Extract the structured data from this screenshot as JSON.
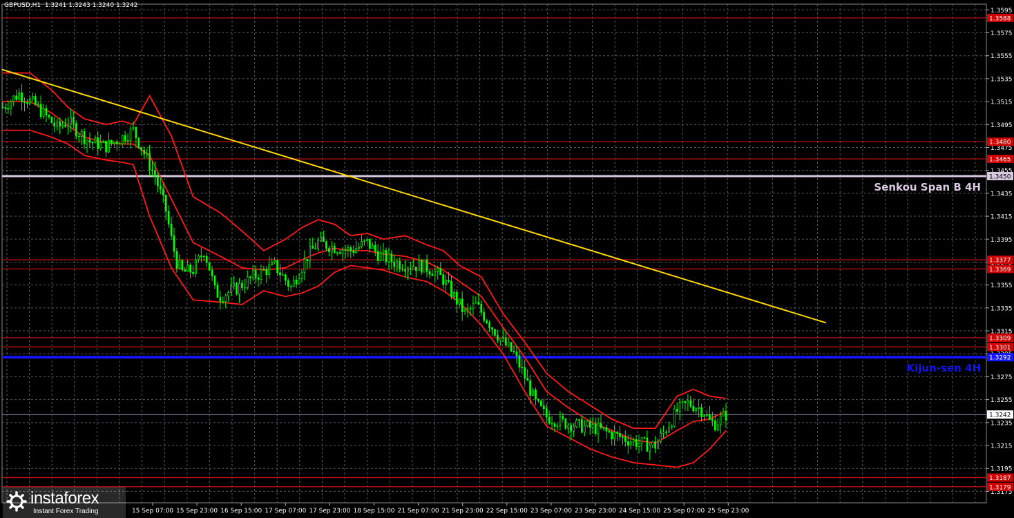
{
  "header": {
    "title": "GBPUSD,H1  1.3241 1.3243 1.3240 1.3242"
  },
  "watermark": {
    "brand": "instaforex",
    "tagline": "Instant Forex Trading"
  },
  "colors": {
    "background": "#000000",
    "grid": "#5a5a5a",
    "candle": "#00ff00",
    "bollinger": "#ff1a1a",
    "trendline": "#ffd700",
    "levels": "#d01010",
    "kijun": "#1515ff",
    "senkou": "#d8c8e0"
  },
  "chart_data": {
    "type": "candlestick",
    "symbol": "GBPUSD",
    "timeframe": "H1",
    "ylim": [
      1.3165,
      1.36
    ],
    "y_ticks": [
      "1.3595",
      "1.3575",
      "1.3555",
      "1.3535",
      "1.3515",
      "1.3495",
      "1.3475",
      "1.3455",
      "1.3435",
      "1.3415",
      "1.3395",
      "1.3375",
      "1.3355",
      "1.3335",
      "1.3315",
      "1.3295",
      "1.3275",
      "1.3255",
      "1.3235",
      "1.3215",
      "1.3195",
      "1.3175"
    ],
    "x_ticks": [
      "15 Sep 07:00",
      "15 Sep 23:00",
      "16 Sep 15:00",
      "17 Sep 07:00",
      "17 Sep 23:00",
      "18 Sep 15:00",
      "21 Sep 07:00",
      "21 Sep 23:00",
      "22 Sep 15:00",
      "23 Sep 07:00",
      "23 Sep 23:00",
      "24 Sep 15:00",
      "25 Sep 07:00",
      "25 Sep 23:00"
    ],
    "current_price": "1.3242",
    "levels": [
      {
        "price": 1.3588,
        "label": "1.3588"
      },
      {
        "price": 1.348,
        "label": "1.3480"
      },
      {
        "price": 1.3465,
        "label": "1.3465"
      },
      {
        "price": 1.3377,
        "label": "1.3377"
      },
      {
        "price": 1.3369,
        "label": "1.3369"
      },
      {
        "price": 1.3309,
        "label": "1.3309"
      },
      {
        "price": 1.3301,
        "label": "1.3301"
      },
      {
        "price": 1.3187,
        "label": "1.3187"
      },
      {
        "price": 1.3179,
        "label": "1.3179"
      }
    ],
    "kijun_sen": {
      "price": 1.3292,
      "label": "1.3292",
      "text": "Kijun-sen 4H"
    },
    "senkou_span_b": {
      "price": 1.345,
      "label": "1.3450",
      "text": "Senkou Span B 4H"
    },
    "trendline": {
      "start": {
        "x": "15 Sep 00:00",
        "y": 1.3543
      },
      "end": {
        "x": "26 Sep 02:00",
        "y": 1.3322
      }
    },
    "price_path": [
      [
        0,
        1.351
      ],
      [
        6,
        1.3522
      ],
      [
        12,
        1.3512
      ],
      [
        16,
        1.3502
      ],
      [
        20,
        1.3492
      ],
      [
        24,
        1.3498
      ],
      [
        28,
        1.3488
      ],
      [
        32,
        1.348
      ],
      [
        38,
        1.3476
      ],
      [
        44,
        1.3484
      ],
      [
        48,
        1.349
      ],
      [
        52,
        1.347
      ],
      [
        56,
        1.345
      ],
      [
        60,
        1.342
      ],
      [
        62,
        1.3395
      ],
      [
        64,
        1.3375
      ],
      [
        66,
        1.3366
      ],
      [
        70,
        1.3368
      ],
      [
        74,
        1.3385
      ],
      [
        76,
        1.337
      ],
      [
        78,
        1.335
      ],
      [
        80,
        1.3345
      ],
      [
        86,
        1.3352
      ],
      [
        92,
        1.3362
      ],
      [
        100,
        1.3372
      ],
      [
        106,
        1.3353
      ],
      [
        112,
        1.338
      ],
      [
        116,
        1.3392
      ],
      [
        122,
        1.3388
      ],
      [
        128,
        1.3385
      ],
      [
        134,
        1.3392
      ],
      [
        138,
        1.3382
      ],
      [
        144,
        1.3375
      ],
      [
        150,
        1.3372
      ],
      [
        154,
        1.3372
      ],
      [
        158,
        1.3368
      ],
      [
        162,
        1.336
      ],
      [
        166,
        1.3345
      ],
      [
        170,
        1.333
      ],
      [
        174,
        1.3338
      ],
      [
        178,
        1.3325
      ],
      [
        184,
        1.3305
      ],
      [
        188,
        1.3295
      ],
      [
        192,
        1.3275
      ],
      [
        196,
        1.3252
      ],
      [
        200,
        1.324
      ],
      [
        206,
        1.3235
      ],
      [
        212,
        1.3232
      ],
      [
        218,
        1.323
      ],
      [
        224,
        1.3225
      ],
      [
        230,
        1.322
      ],
      [
        236,
        1.3216
      ],
      [
        240,
        1.3215
      ],
      [
        244,
        1.323
      ],
      [
        248,
        1.3245
      ],
      [
        252,
        1.3252
      ],
      [
        256,
        1.3248
      ],
      [
        258,
        1.3244
      ],
      [
        260,
        1.3236
      ],
      [
        262,
        1.3234
      ],
      [
        266,
        1.3242
      ]
    ],
    "bollinger_upper": [
      [
        0,
        1.354
      ],
      [
        10,
        1.354
      ],
      [
        18,
        1.3525
      ],
      [
        24,
        1.351
      ],
      [
        30,
        1.35
      ],
      [
        38,
        1.3495
      ],
      [
        44,
        1.3498
      ],
      [
        48,
        1.3495
      ],
      [
        54,
        1.352
      ],
      [
        62,
        1.3485
      ],
      [
        70,
        1.3432
      ],
      [
        80,
        1.3418
      ],
      [
        88,
        1.3402
      ],
      [
        96,
        1.3385
      ],
      [
        104,
        1.3395
      ],
      [
        110,
        1.3405
      ],
      [
        116,
        1.3412
      ],
      [
        122,
        1.3408
      ],
      [
        128,
        1.3398
      ],
      [
        134,
        1.34
      ],
      [
        140,
        1.3395
      ],
      [
        148,
        1.3398
      ],
      [
        156,
        1.339
      ],
      [
        162,
        1.3385
      ],
      [
        168,
        1.3372
      ],
      [
        176,
        1.3362
      ],
      [
        184,
        1.333
      ],
      [
        192,
        1.3305
      ],
      [
        200,
        1.3278
      ],
      [
        208,
        1.3262
      ],
      [
        216,
        1.325
      ],
      [
        224,
        1.3238
      ],
      [
        232,
        1.323
      ],
      [
        240,
        1.323
      ],
      [
        248,
        1.3258
      ],
      [
        254,
        1.3264
      ],
      [
        260,
        1.3258
      ],
      [
        266,
        1.3256
      ]
    ],
    "bollinger_mid": [
      [
        0,
        1.3515
      ],
      [
        10,
        1.3515
      ],
      [
        18,
        1.3505
      ],
      [
        24,
        1.3494
      ],
      [
        30,
        1.3484
      ],
      [
        38,
        1.3479
      ],
      [
        44,
        1.3478
      ],
      [
        48,
        1.3478
      ],
      [
        54,
        1.3468
      ],
      [
        62,
        1.343
      ],
      [
        70,
        1.3392
      ],
      [
        80,
        1.338
      ],
      [
        88,
        1.337
      ],
      [
        96,
        1.3368
      ],
      [
        104,
        1.337
      ],
      [
        110,
        1.3377
      ],
      [
        116,
        1.3383
      ],
      [
        122,
        1.3387
      ],
      [
        128,
        1.3385
      ],
      [
        134,
        1.3385
      ],
      [
        140,
        1.3382
      ],
      [
        148,
        1.338
      ],
      [
        156,
        1.3375
      ],
      [
        162,
        1.3368
      ],
      [
        168,
        1.3358
      ],
      [
        176,
        1.3345
      ],
      [
        184,
        1.3318
      ],
      [
        192,
        1.3292
      ],
      [
        200,
        1.3262
      ],
      [
        208,
        1.3248
      ],
      [
        216,
        1.3236
      ],
      [
        224,
        1.3228
      ],
      [
        232,
        1.322
      ],
      [
        240,
        1.3217
      ],
      [
        248,
        1.3228
      ],
      [
        254,
        1.3236
      ],
      [
        260,
        1.3238
      ],
      [
        266,
        1.3245
      ]
    ],
    "bollinger_lower": [
      [
        0,
        1.349
      ],
      [
        10,
        1.349
      ],
      [
        18,
        1.3484
      ],
      [
        24,
        1.3478
      ],
      [
        30,
        1.3468
      ],
      [
        38,
        1.3464
      ],
      [
        44,
        1.3462
      ],
      [
        48,
        1.346
      ],
      [
        54,
        1.3415
      ],
      [
        62,
        1.337
      ],
      [
        70,
        1.3342
      ],
      [
        80,
        1.334
      ],
      [
        88,
        1.3338
      ],
      [
        96,
        1.335
      ],
      [
        104,
        1.3345
      ],
      [
        110,
        1.3348
      ],
      [
        116,
        1.3354
      ],
      [
        122,
        1.3366
      ],
      [
        128,
        1.3372
      ],
      [
        134,
        1.337
      ],
      [
        140,
        1.3368
      ],
      [
        148,
        1.3362
      ],
      [
        156,
        1.3358
      ],
      [
        162,
        1.335
      ],
      [
        168,
        1.334
      ],
      [
        176,
        1.332
      ],
      [
        184,
        1.3295
      ],
      [
        192,
        1.3262
      ],
      [
        200,
        1.3232
      ],
      [
        208,
        1.3222
      ],
      [
        216,
        1.3212
      ],
      [
        224,
        1.3205
      ],
      [
        232,
        1.32
      ],
      [
        240,
        1.3198
      ],
      [
        248,
        1.3196
      ],
      [
        254,
        1.32
      ],
      [
        260,
        1.3212
      ],
      [
        266,
        1.3228
      ]
    ]
  }
}
